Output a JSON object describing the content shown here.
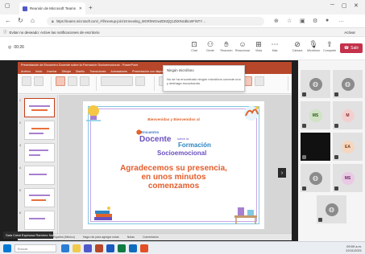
{
  "browser": {
    "tab_title": "Reunión de Microsoft Teams",
    "url": "https://teams.microsoft.com/_#/l/meetup-join/19:meeting_MGRhNGIwZDItZjQ1Zi00NzdkLWFiNTY…",
    "notification_text": "Evitar no deseado: Active las notificaciones de escritorio",
    "notification_action": "Activar"
  },
  "meeting": {
    "timer": "00:26",
    "tools": [
      {
        "label": "Chat",
        "icon": "chat-icon"
      },
      {
        "label": "Gente",
        "icon": "people-icon"
      },
      {
        "label": "Reacción",
        "icon": "raise-hand-icon"
      },
      {
        "label": "Reaccionar",
        "icon": "reaction-icon"
      },
      {
        "label": "Vista",
        "icon": "view-icon"
      },
      {
        "label": "Más",
        "icon": "more-icon"
      },
      {
        "label": "Cámara",
        "icon": "camera-icon"
      },
      {
        "label": "Micrófono",
        "icon": "mic-icon"
      },
      {
        "label": "Compartir",
        "icon": "share-icon"
      }
    ],
    "leave_label": "Salir"
  },
  "powerpoint": {
    "title": "Presentación de Encuentro Docente sobre la Formación Socioemocional - PowerPoint",
    "menu": [
      "Archivo",
      "Inicio",
      "Insertar",
      "Dibujar",
      "Diseño",
      "Transiciones",
      "Animaciones",
      "Presentación con diapositivas",
      "Revisar",
      "Vista",
      "Ayuda"
    ],
    "status": [
      "Diapositiva 1 de 18",
      "Español (México)",
      "Notas",
      "Comentarios"
    ],
    "notes_hint": "Haga clic para agregar notas",
    "slide_numbers": [
      "1",
      "2",
      "3",
      "4",
      "5",
      "6"
    ]
  },
  "slide": {
    "welcome": "Bienvenidas y Bienvenidos al",
    "logo_line1": "Encuentro",
    "logo_line2": "Docente",
    "logo_line3": "sobre la",
    "logo_line4": "Formación",
    "logo_line5": "Socioemocional",
    "message": [
      "Agradecemos su presencia,",
      "en unos minutos",
      "comenzamos"
    ]
  },
  "popup": {
    "title": "Ningún micrófono",
    "body": "No se ha encontrado ningún micrófono conecte uno y deshaga escuchando."
  },
  "sharer_name": "Sala Cofat Espinosa Ramírez Nayeli",
  "participants": [
    {
      "kind": "person",
      "label": ""
    },
    {
      "kind": "person",
      "label": ""
    },
    {
      "kind": "initials",
      "label": "MS"
    },
    {
      "kind": "initials",
      "label": "M"
    },
    {
      "kind": "video",
      "label": ""
    },
    {
      "kind": "initials",
      "label": "EA"
    },
    {
      "kind": "person",
      "label": ""
    },
    {
      "kind": "initials",
      "label": "MS"
    },
    {
      "kind": "person",
      "label": ""
    }
  ],
  "taskbar": {
    "search_placeholder": "Buscar",
    "time": "09:59 a.m.",
    "date": "22/11/2021"
  }
}
